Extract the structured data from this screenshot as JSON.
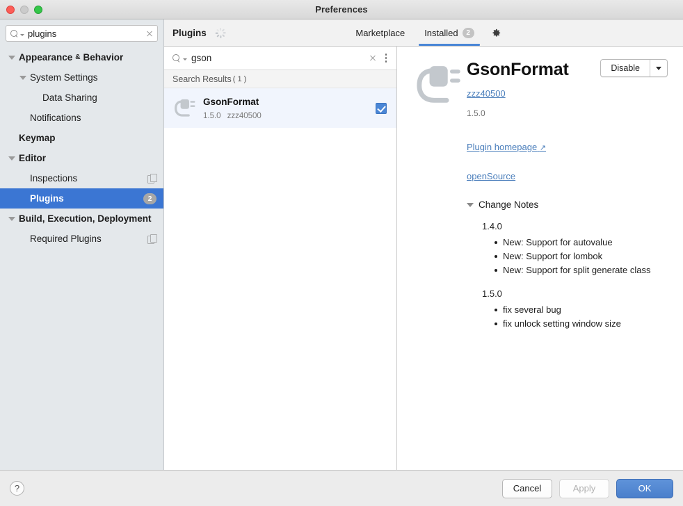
{
  "window": {
    "title": "Preferences",
    "traffic_lights": [
      "close-button",
      "minimize-button",
      "zoom-button"
    ]
  },
  "sidebar": {
    "search": {
      "value": "plugins",
      "placeholder": "Search settings"
    },
    "items": [
      {
        "label": "Appearance",
        "label2": "Behavior",
        "amp": "&",
        "bold": true,
        "indent": 0,
        "arrow": "down",
        "selected": false,
        "badge": null,
        "copy_icon": false
      },
      {
        "label": "System Settings",
        "bold": false,
        "indent": 1,
        "arrow": "down",
        "selected": false,
        "badge": null,
        "copy_icon": false
      },
      {
        "label": "Data Sharing",
        "bold": false,
        "indent": 2,
        "arrow": "none",
        "selected": false,
        "badge": null,
        "copy_icon": false
      },
      {
        "label": "Notifications",
        "bold": false,
        "indent": 1,
        "arrow": "none",
        "selected": false,
        "badge": null,
        "copy_icon": false
      },
      {
        "label": "Keymap",
        "bold": true,
        "indent": 0,
        "arrow": "none",
        "selected": false,
        "badge": null,
        "copy_icon": false
      },
      {
        "label": "Editor",
        "bold": true,
        "indent": 0,
        "arrow": "down",
        "selected": false,
        "badge": null,
        "copy_icon": false
      },
      {
        "label": "Inspections",
        "bold": false,
        "indent": 1,
        "arrow": "none",
        "selected": false,
        "badge": null,
        "copy_icon": true
      },
      {
        "label": "Plugins",
        "bold": true,
        "indent": 1,
        "arrow": "none",
        "selected": true,
        "badge": "2",
        "copy_icon": false
      },
      {
        "label": "Build, Execution, Deployment",
        "bold": true,
        "indent": 0,
        "arrow": "down",
        "selected": false,
        "badge": null,
        "copy_icon": false
      },
      {
        "label": "Required Plugins",
        "bold": false,
        "indent": 1,
        "arrow": "none",
        "selected": false,
        "badge": null,
        "copy_icon": true
      }
    ]
  },
  "plugins_header": {
    "title": "Plugins",
    "spinner": "loading-spinner",
    "tabs": [
      {
        "label": "Marketplace",
        "badge": null,
        "active": false
      },
      {
        "label": "Installed",
        "badge": "2",
        "active": true
      }
    ],
    "settings_icon": "gear-icon"
  },
  "plugin_list": {
    "search": {
      "value": "gson",
      "placeholder": "Search plugins"
    },
    "results_label": "Search Results",
    "results_count": "( 1 )",
    "rows": [
      {
        "name": "GsonFormat",
        "version": "1.5.0",
        "vendor": "zzz40500",
        "enabled": true,
        "selected": true
      }
    ]
  },
  "plugin_detail": {
    "title": "GsonFormat",
    "vendor": "zzz40500",
    "version": "1.5.0",
    "action_button": "Disable",
    "homepage_link": "Plugin homepage",
    "homepage_arrow": "↗",
    "tag": "openSource",
    "change_notes_label": "Change Notes",
    "change_notes": [
      {
        "version": "1.4.0",
        "entries": [
          {
            "prefix": "New:",
            "text": "Support for autovalue"
          },
          {
            "prefix": "New:",
            "text": "Support for lombok"
          },
          {
            "prefix": "New:",
            "text": "Support for split generate class"
          }
        ]
      },
      {
        "version": "1.5.0",
        "entries": [
          {
            "prefix": "",
            "text": "fix several bug"
          },
          {
            "prefix": "",
            "text": "fix unlock setting window size"
          }
        ]
      }
    ]
  },
  "footer": {
    "help": "?",
    "cancel": "Cancel",
    "apply": "Apply",
    "ok": "OK"
  },
  "colors": {
    "selection_blue": "#3b76d3",
    "accent_blue": "#4a86d6",
    "link_blue": "#4a7ebb",
    "sidebar_bg": "#e4e8eb",
    "row_selected_bg": "#f1f5fd"
  }
}
